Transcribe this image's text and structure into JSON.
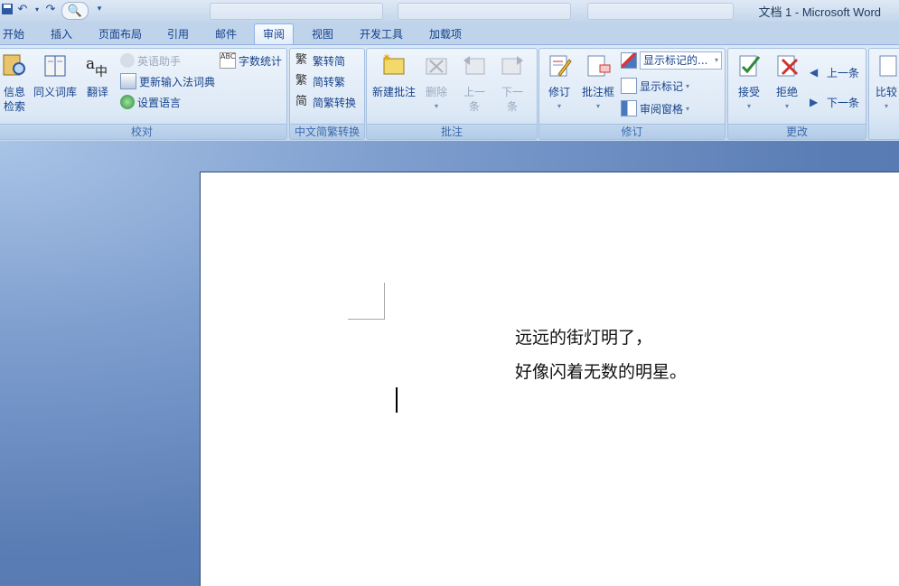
{
  "titlebar": {
    "title": "文档 1 - Microsoft Word"
  },
  "tabs": [
    {
      "label": "开始"
    },
    {
      "label": "插入"
    },
    {
      "label": "页面布局"
    },
    {
      "label": "引用"
    },
    {
      "label": "邮件"
    },
    {
      "label": "审阅",
      "active": true
    },
    {
      "label": "视图"
    },
    {
      "label": "开发工具"
    },
    {
      "label": "加载项"
    }
  ],
  "ribbon": {
    "proofing": {
      "group_label": "校对",
      "research_line1": "信息",
      "research_line2": "检索",
      "thesaurus": "同义词库",
      "translate": "翻译",
      "english_assistant": "英语助手",
      "update_ime": "更新输入法词典",
      "set_language": "设置语言",
      "word_count": "字数统计"
    },
    "chinese_conversion": {
      "group_label": "中文简繁转换",
      "to_simplified": "繁转简",
      "to_traditional": "简转繁",
      "convert": "简繁转换"
    },
    "comments": {
      "group_label": "批注",
      "new_comment": "新建批注",
      "delete": "删除",
      "previous": "上一条",
      "next": "下一条"
    },
    "tracking": {
      "group_label": "修订",
      "track_changes": "修订",
      "balloons": "批注框",
      "display_for_review": "显示标记的...",
      "show_markup": "显示标记",
      "reviewing_pane": "审阅窗格"
    },
    "changes": {
      "group_label": "更改",
      "accept": "接受",
      "reject": "拒绝",
      "previous": "上一条",
      "next": "下一条"
    },
    "compare": {
      "label": "比较"
    }
  },
  "document": {
    "line1": "远远的街灯明了，",
    "line2": "好像闪着无数的明星。"
  }
}
